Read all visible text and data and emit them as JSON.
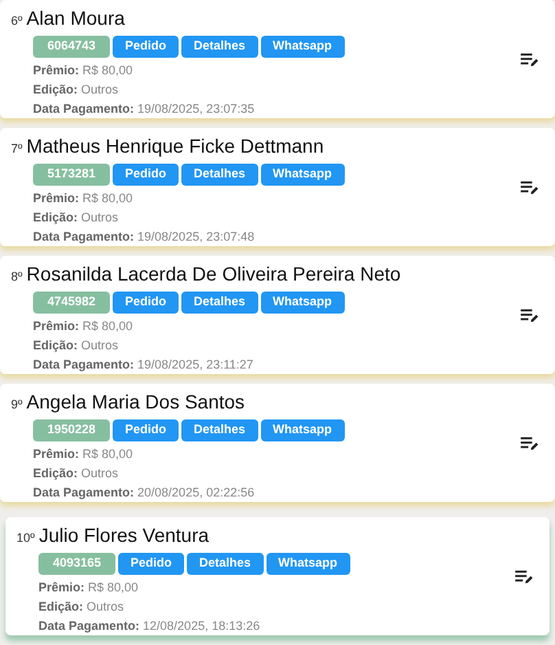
{
  "entries": [
    {
      "rank": "6º",
      "name": "Alan Moura",
      "code": "6064743",
      "buttons": [
        "Pedido",
        "Detalhes",
        "Whatsapp"
      ],
      "fields": [
        {
          "label": "Prêmio:",
          "value": "R$ 80,00"
        },
        {
          "label": "Edição:",
          "value": "Outros"
        },
        {
          "label": "Data Pagamento:",
          "value": "19/08/2025, 23:07:35"
        }
      ],
      "selected": false
    },
    {
      "rank": "7º",
      "name": "Matheus Henrique Ficke Dettmann",
      "code": "5173281",
      "buttons": [
        "Pedido",
        "Detalhes",
        "Whatsapp"
      ],
      "fields": [
        {
          "label": "Prêmio:",
          "value": "R$ 80,00"
        },
        {
          "label": "Edição:",
          "value": "Outros"
        },
        {
          "label": "Data Pagamento:",
          "value": "19/08/2025, 23:07:48"
        }
      ],
      "selected": false
    },
    {
      "rank": "8º",
      "name": "Rosanilda Lacerda De Oliveira Pereira Neto",
      "code": "4745982",
      "buttons": [
        "Pedido",
        "Detalhes",
        "Whatsapp"
      ],
      "fields": [
        {
          "label": "Prêmio:",
          "value": "R$ 80,00"
        },
        {
          "label": "Edição:",
          "value": "Outros"
        },
        {
          "label": "Data Pagamento:",
          "value": "19/08/2025, 23:11:27"
        }
      ],
      "selected": false
    },
    {
      "rank": "9º",
      "name": "Angela Maria Dos Santos",
      "code": "1950228",
      "buttons": [
        "Pedido",
        "Detalhes",
        "Whatsapp"
      ],
      "fields": [
        {
          "label": "Prêmio:",
          "value": "R$ 80,00"
        },
        {
          "label": "Edição:",
          "value": "Outros"
        },
        {
          "label": "Data Pagamento:",
          "value": "20/08/2025, 02:22:56"
        }
      ],
      "selected": false
    },
    {
      "rank": "10º",
      "name": "Julio Flores Ventura",
      "code": "4093165",
      "buttons": [
        "Pedido",
        "Detalhes",
        "Whatsapp"
      ],
      "fields": [
        {
          "label": "Prêmio:",
          "value": "R$ 80,00"
        },
        {
          "label": "Edição:",
          "value": "Outros"
        },
        {
          "label": "Data Pagamento:",
          "value": "12/08/2025, 18:13:26"
        }
      ],
      "selected": true
    }
  ]
}
